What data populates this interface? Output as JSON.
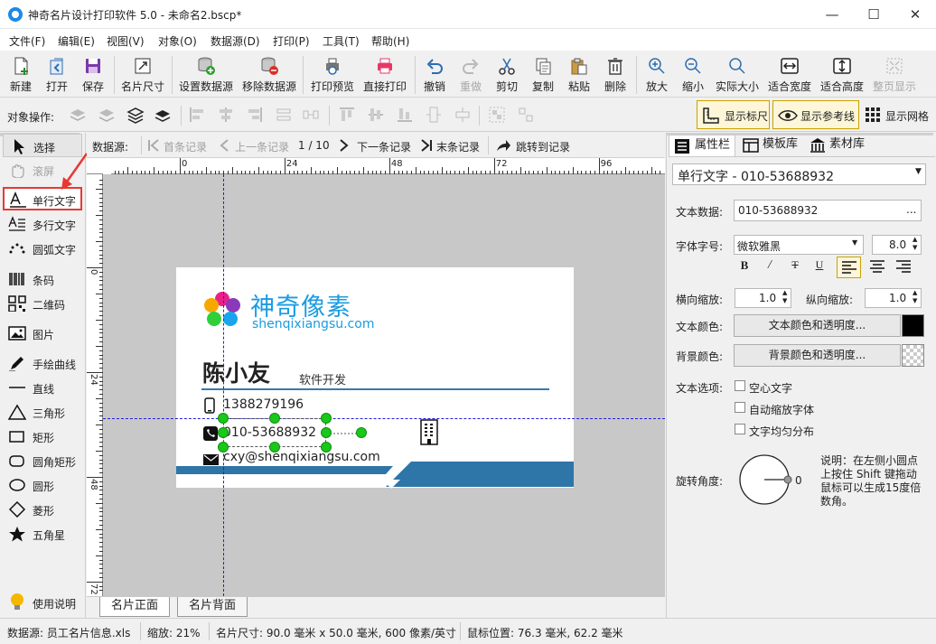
{
  "window": {
    "title": "神奇名片设计打印软件 5.0 - 未命名2.bscp*",
    "minimize": "—",
    "maximize": "☐",
    "close": "✕"
  },
  "menu": [
    "文件(F)",
    "编辑(E)",
    "视图(V)",
    "对象(O)",
    "数据源(D)",
    "打印(P)",
    "工具(T)",
    "帮助(H)"
  ],
  "toolbar": {
    "new": "新建",
    "open": "打开",
    "save": "保存",
    "card_size": "名片尺寸",
    "set_datasource": "设置数据源",
    "remove_datasource": "移除数据源",
    "print_preview": "打印预览",
    "direct_print": "直接打印",
    "undo": "撤销",
    "redo": "重做",
    "cut": "剪切",
    "copy": "复制",
    "paste": "粘贴",
    "delete": "删除",
    "zoom_in": "放大",
    "zoom_out": "缩小",
    "actual_size": "实际大小",
    "fit_width": "适合宽度",
    "fit_height": "适合高度",
    "fit_page": "整页显示"
  },
  "object_bar": {
    "label": "对象操作:",
    "show_ruler": "显示标尺",
    "show_guides": "显示参考线",
    "show_grid": "显示网格"
  },
  "tools": [
    "选择",
    "滚屏",
    "单行文字",
    "多行文字",
    "圆弧文字",
    "条码",
    "二维码",
    "图片",
    "手绘曲线",
    "直线",
    "三角形",
    "矩形",
    "圆角矩形",
    "圆形",
    "菱形",
    "五角星",
    "使用说明"
  ],
  "record_bar": {
    "label": "数据源:",
    "first": "首条记录",
    "prev": "上一条记录",
    "position": "1 / 10",
    "next": "下一条记录",
    "last": "末条记录",
    "jump": "跳转到记录"
  },
  "ruler": {
    "h": [
      "0",
      "24",
      "48",
      "72",
      "96"
    ],
    "v": [
      "0",
      "24",
      "48",
      "72"
    ]
  },
  "card": {
    "brand": "神奇像素",
    "website": "shenqixiangsu.com",
    "name": "陈小友",
    "position": "软件开发",
    "mobile": "1388279196",
    "phone": "010-53688932",
    "email": "cxy@shenqixiangsu.com",
    "colors": {
      "brand": "#1a9be0",
      "bar": "#2e75a8",
      "divider": "#3a7aa8"
    }
  },
  "canvas_tabs": [
    "名片正面",
    "名片背面"
  ],
  "panel": {
    "tabs": [
      "属性栏",
      "模板库",
      "素材库"
    ],
    "object_select": "单行文字 - 010-53688932",
    "text_data_label": "文本数据:",
    "text_data": "010-53688932",
    "font_label": "字体字号:",
    "font": "微软雅黑",
    "font_size": "8.0",
    "h_scale_label": "横向缩放:",
    "h_scale": "1.0",
    "v_scale_label": "纵向缩放:",
    "v_scale": "1.0",
    "text_color_label": "文本颜色:",
    "text_color_btn": "文本颜色和透明度...",
    "bg_color_label": "背景颜色:",
    "bg_color_btn": "背景颜色和透明度...",
    "options_label": "文本选项:",
    "opt_hollow": "空心文字",
    "opt_autoscale": "自动缩放字体",
    "opt_distribute": "文字均匀分布",
    "rotation_label": "旋转角度:",
    "rotation_value": "0",
    "note": "说明：在左侧小圆点上按住 Shift 键拖动鼠标可以生成15度倍数角。"
  },
  "status": {
    "datasource": "数据源: 员工名片信息.xls",
    "zoom": "缩放: 21%",
    "size": "名片尺寸: 90.0 毫米 x 50.0 毫米, 600 像素/英寸",
    "mouse": "鼠标位置: 76.3 毫米, 62.2 毫米"
  }
}
